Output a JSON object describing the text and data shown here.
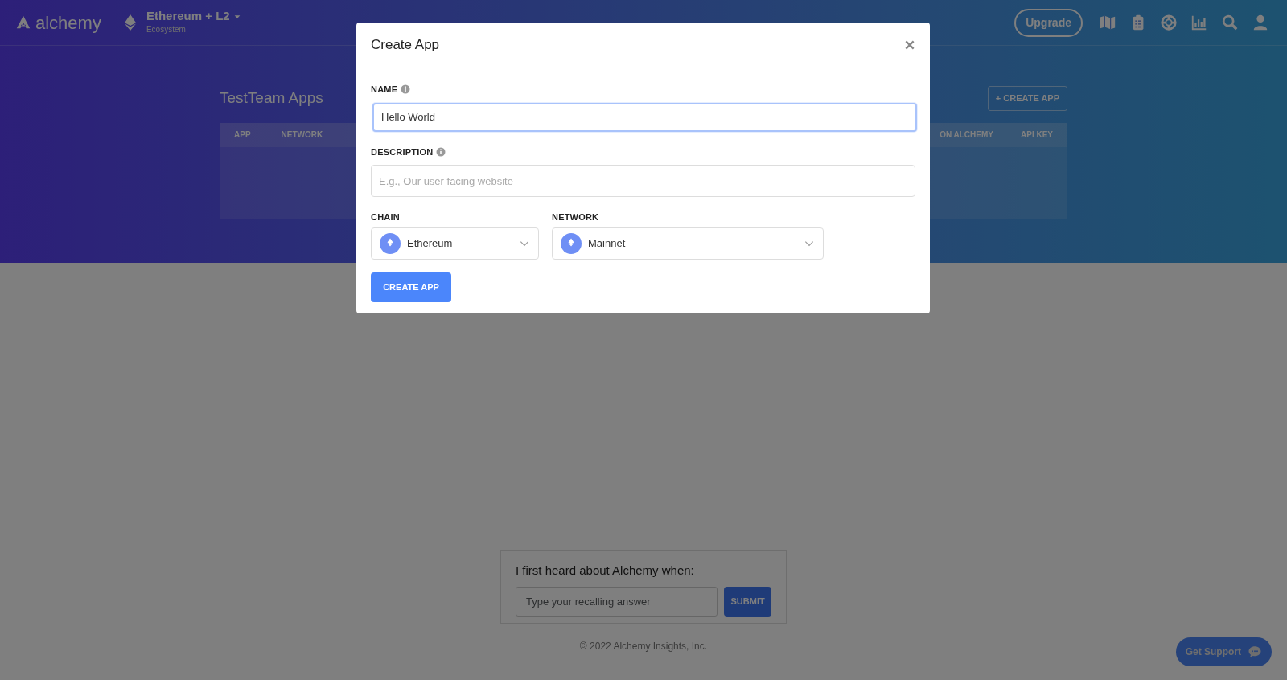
{
  "navbar": {
    "logo_text": "alchemy",
    "ecosystem": {
      "title": "Ethereum + L2",
      "subtitle": "Ecosystem"
    },
    "upgrade": "Upgrade"
  },
  "page": {
    "title": "TestTeam Apps",
    "create_button": "+ CREATE APP",
    "table": {
      "columns": [
        "APP",
        "NETWORK",
        "ON ALCHEMY",
        "API KEY"
      ]
    }
  },
  "modal": {
    "title": "Create App",
    "fields": [
      {
        "label": "NAME",
        "info": true,
        "value": "Hello World",
        "focused": true
      },
      {
        "label": "DESCRIPTION",
        "info": true,
        "placeholder": "E.g., Our user facing website",
        "focused": false
      }
    ],
    "selects": [
      {
        "label": "CHAIN",
        "value": "Ethereum"
      },
      {
        "label": "NETWORK",
        "value": "Mainnet"
      }
    ],
    "submit": "CREATE APP"
  },
  "survey": {
    "question": "I first heard about Alchemy when:",
    "placeholder": "Type your recalling answer",
    "submit": "SUBMIT"
  },
  "footer": "© 2022 Alchemy Insights, Inc.",
  "support_button": "Get Support"
}
